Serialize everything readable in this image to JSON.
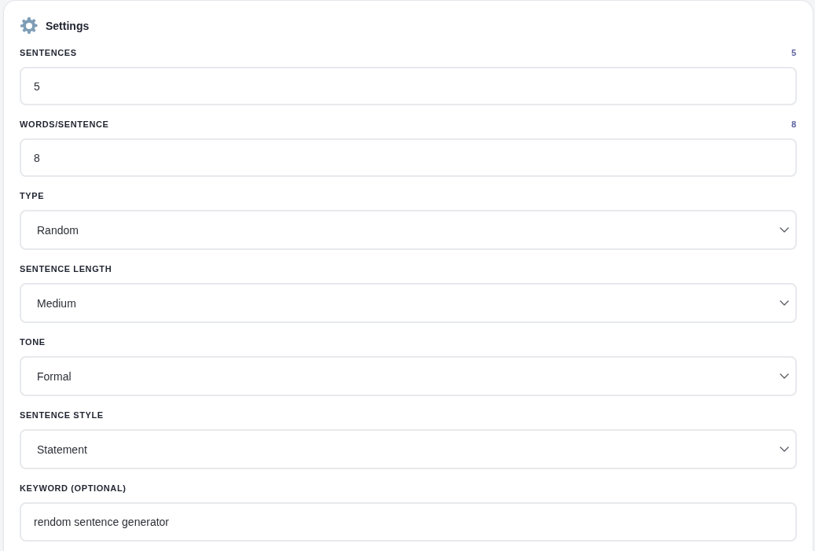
{
  "panel": {
    "title": "Settings"
  },
  "fields": [
    {
      "kind": "number",
      "label": "SENTENCES",
      "reading": "5",
      "value": "5"
    },
    {
      "kind": "number",
      "label": "WORDS/SENTENCE",
      "reading": "8",
      "value": "8"
    },
    {
      "kind": "select",
      "label": "TYPE",
      "value": "Random"
    },
    {
      "kind": "select",
      "label": "SENTENCE LENGTH",
      "value": "Medium"
    },
    {
      "kind": "select",
      "label": "TONE",
      "value": "Formal"
    },
    {
      "kind": "select",
      "label": "SENTENCE STYLE",
      "value": "Statement"
    },
    {
      "kind": "text",
      "label": "KEYWORD (OPTIONAL)",
      "value": "rendom sentence generator"
    }
  ]
}
